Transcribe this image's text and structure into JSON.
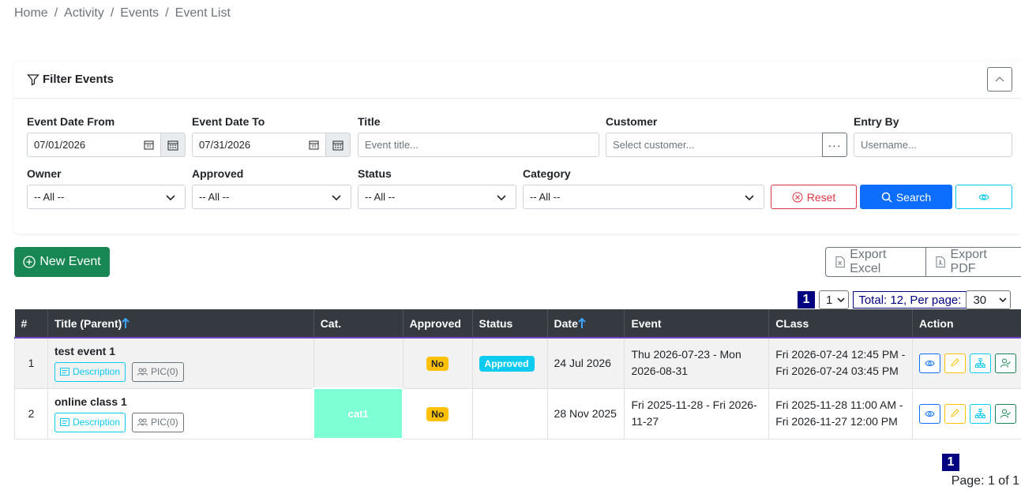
{
  "breadcrumb": [
    "Home",
    "Activity",
    "Events",
    "Event List"
  ],
  "filter": {
    "title": "Filter Events",
    "event_date_from": {
      "label": "Event Date From",
      "value": "07/01/2026"
    },
    "event_date_to": {
      "label": "Event Date To",
      "value": "07/31/2026"
    },
    "title_field": {
      "label": "Title",
      "placeholder": "Event title..."
    },
    "customer": {
      "label": "Customer",
      "placeholder": "Select customer...",
      "button": "···"
    },
    "entry_by": {
      "label": "Entry By",
      "placeholder": "Username..."
    },
    "owner": {
      "label": "Owner",
      "value": "-- All --"
    },
    "approved": {
      "label": "Approved",
      "value": "-- All --"
    },
    "status": {
      "label": "Status",
      "value": "-- All --"
    },
    "category": {
      "label": "Category",
      "value": "-- All --"
    },
    "reset_label": "Reset",
    "search_label": "Search"
  },
  "toolbar": {
    "new_event": "New Event",
    "export_excel": "Export Excel",
    "export_pdf": "Export PDF"
  },
  "pager": {
    "current_page": "1",
    "page_select": "1",
    "total_text": "Total: 12, Per page:",
    "per_page": "30",
    "page_info": "Page: 1 of 1"
  },
  "table": {
    "headers": [
      "#",
      "Title (Parent)",
      "Cat.",
      "Approved",
      "Status",
      "Date",
      "Event",
      "CLass",
      "Action"
    ],
    "desc_label": "Description",
    "pic_label": "PIC(0)",
    "rows": [
      {
        "num": "1",
        "title": "test event 1",
        "cat": "",
        "approved": "No",
        "status": "Approved",
        "date": "24 Jul 2026",
        "event": "Thu 2026-07-23 - Mon 2026-08-31",
        "class": "Fri 2026-07-24 12:45 PM - Fri 2026-07-24 03:45 PM"
      },
      {
        "num": "2",
        "title": "online class 1",
        "cat": "cat1",
        "approved": "No",
        "status": "",
        "date": "28 Nov 2025",
        "event": "Fri 2025-11-28 - Fri 2026-11-27",
        "class": "Fri 2025-11-28 11:00 AM - Fri 2026-11-27 12:00 PM"
      }
    ]
  },
  "colors": {
    "primary": "#0d6efd",
    "success": "#198754",
    "warning": "#ffc107",
    "info": "#0dcaf0",
    "danger": "#dc3545",
    "header_dark": "#343a40",
    "pager_navy": "#000080",
    "cat1_bg": "#7fffd4"
  }
}
